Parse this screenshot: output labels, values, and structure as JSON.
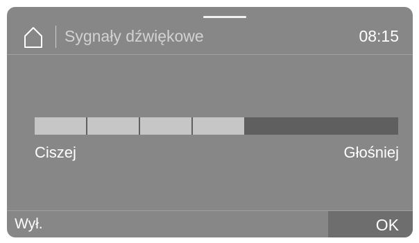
{
  "header": {
    "title": "Sygnały dźwiękowe",
    "time": "08:15",
    "home_icon": "home-icon"
  },
  "volume": {
    "level_segments": 4,
    "total_segments": 7,
    "min_label": "Ciszej",
    "max_label": "Głośniej"
  },
  "footer": {
    "off_label": "Wył.",
    "ok_label": "OK"
  },
  "colors": {
    "background": "#878787",
    "segment_filled": "#c6c6c6",
    "segment_empty": "#5f5f5f",
    "ok_button": "#6e6e6e"
  }
}
